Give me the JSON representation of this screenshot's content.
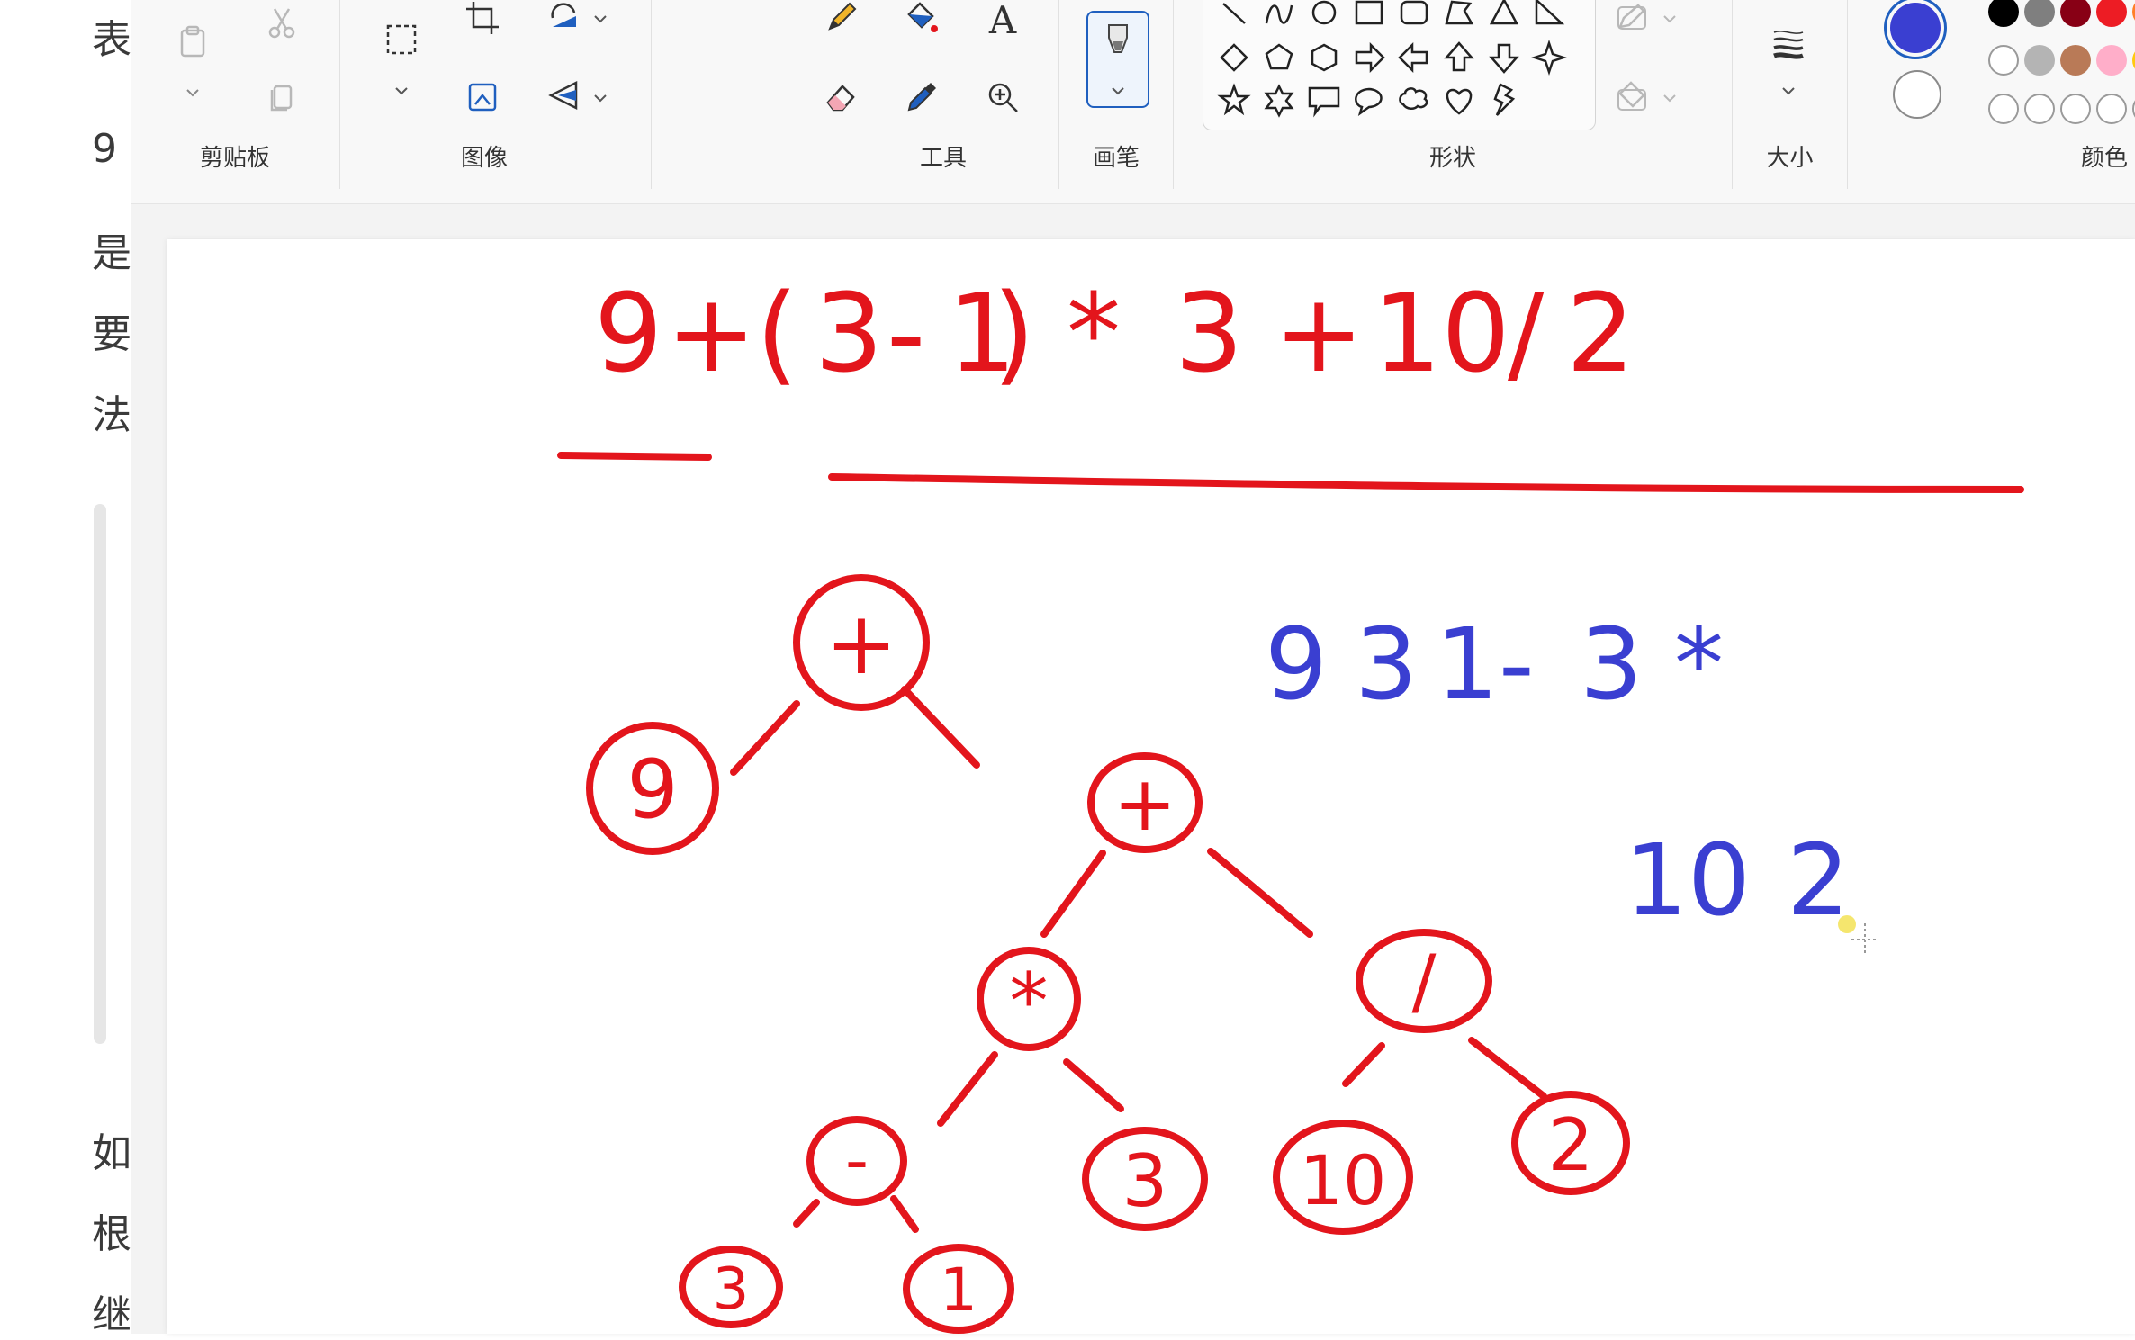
{
  "background_doc": {
    "chars": [
      "表",
      "9",
      "是",
      "要",
      "法",
      "如",
      "根",
      "继"
    ]
  },
  "ribbon": {
    "groups": {
      "clipboard": "剪贴板",
      "image": "图像",
      "tools": "工具",
      "brush": "画笔",
      "shapes": "形状",
      "size": "大小",
      "colors": "颜色"
    },
    "text_tool_glyph": "A",
    "palette": [
      "#000000",
      "#7f7f7f",
      "#880015",
      "#ed1c24",
      "#ff7f27",
      "#fff200",
      "",
      "#b4b4b4",
      "#b97a57",
      "#ffaec9",
      "#ffc90e",
      "#efe4b0"
    ],
    "color1": "#3a3fd1",
    "color2": "#ffffff"
  },
  "canvas": {
    "infix_expression": {
      "tokens": [
        "9",
        "+",
        "(",
        "3",
        "-",
        "1",
        ")",
        "*",
        "3",
        "+",
        "10",
        "/",
        "2"
      ]
    },
    "postfix_line_1": [
      "9",
      "3",
      "1",
      "-",
      "3",
      "*"
    ],
    "postfix_line_2": [
      "10",
      "2"
    ],
    "tree_nodes": {
      "root": "+",
      "left_leaf": "9",
      "right_plus": "+",
      "mult": "*",
      "div": "/",
      "minus": "-",
      "three_a": "3",
      "ten": "10",
      "two": "2",
      "three_b": "3",
      "one": "1"
    },
    "ink_colors": {
      "red": "#e3151c",
      "blue": "#3a3fd1"
    }
  }
}
